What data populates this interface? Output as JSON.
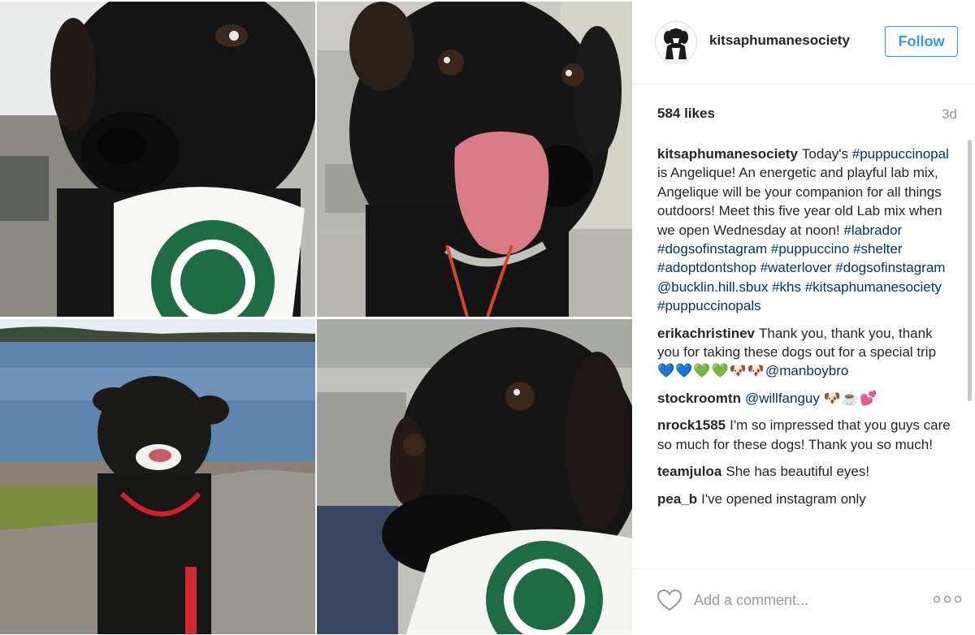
{
  "post": {
    "username": "kitsaphumanesociety",
    "follow_label": "Follow",
    "likes": "584 likes",
    "age": "3d"
  },
  "comments": [
    {
      "user": "kitsaphumanesociety",
      "text": "Today's"
    },
    {
      "user": "erikachristinev",
      "text": "Thank you, thank you, thank you for taking these dogs out for a special trip"
    },
    {
      "user": "stockroomtn",
      "text": ""
    },
    {
      "user": "nrock1585",
      "text": "I'm so impressed that you guys care so much for these dogs! Thank you so much!"
    },
    {
      "user": "teamjuloa",
      "text": "She has beautiful eyes!"
    },
    {
      "user": "pea_b",
      "text": "I've opened instagram only"
    }
  ],
  "caption": {
    "tag1": "#puppuccinopal",
    "text1": "is Angelique! An energetic and playful lab mix, Angelique will be your companion for all things outdoors! Meet this five year old Lab mix when we open Wednesday at noon!",
    "hashtags": [
      "#labrador",
      "#dogsofinstagram",
      "#puppuccino",
      "#shelter",
      "#adoptdontshop",
      "#waterlover",
      "#dogsofinstagram",
      "@bucklin.hill.sbux",
      "#khs",
      "#kitsaphumanesociety",
      "#puppuccinopals"
    ]
  },
  "mentions": {
    "erika_emojis": "💙💙💚💚🐶🐶",
    "erika_mention": "@manboybro",
    "stock_mention": "@willfanguy",
    "stock_emojis": "🐶☕💕"
  },
  "footer": {
    "comment_placeholder": "Add a comment..."
  },
  "icons": {
    "heart": "heart-icon",
    "more": "more-options-icon",
    "avatar": "dog-avatar"
  },
  "colors": {
    "link": "#003569",
    "follow": "#3897f0",
    "meta": "#999999",
    "text": "#262626"
  }
}
